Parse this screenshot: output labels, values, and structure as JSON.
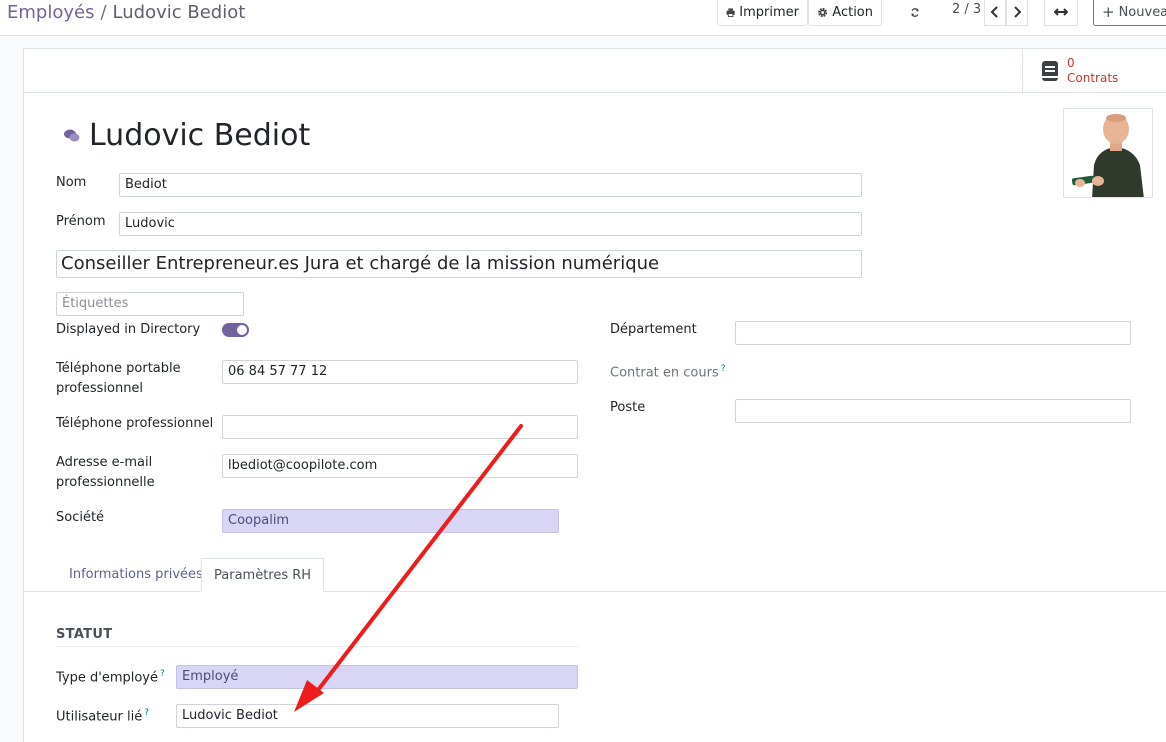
{
  "breadcrumb": {
    "parent": "Employés",
    "separator": "/",
    "current": "Ludovic Bediot"
  },
  "toolbar": {
    "print_label": "Imprimer",
    "action_label": "Action",
    "pager": "2 / 3",
    "new_label": "Nouveau"
  },
  "smart_buttons": {
    "contracts_count": "0",
    "contracts_label": "Contrats"
  },
  "employee": {
    "name": "Ludovic Bediot",
    "nom_label": "Nom",
    "nom": "Bediot",
    "prenom_label": "Prénom",
    "prenom": "Ludovic",
    "job_title": "Conseiller Entrepreneur.es Jura et chargé de la mission numérique",
    "tags_placeholder": "Étiquettes"
  },
  "fields": {
    "directory_label": "Displayed in Directory",
    "directory_on": true,
    "mobile_label_1": "Téléphone portable",
    "mobile_label_2": "professionnel",
    "mobile": "06 84 57 77 12",
    "phone_label": "Téléphone professionnel",
    "phone": "",
    "email_label_1": "Adresse e-mail",
    "email_label_2": "professionnelle",
    "email": "lbediot@coopilote.com",
    "company_label": "Société",
    "company": "Coopalim",
    "department_label": "Département",
    "department": "",
    "contract_label": "Contrat en cours",
    "help_mark": "?",
    "position_label": "Poste",
    "position": ""
  },
  "tabs": [
    {
      "label": "Informations privées"
    },
    {
      "label": "Paramètres RH"
    }
  ],
  "statut": {
    "title": "STATUT",
    "type_label": "Type d'employé",
    "type": "Employé",
    "user_label": "Utilisateur lié",
    "user": "Ludovic Bediot"
  },
  "colors": {
    "accent": "#71639e",
    "annotation_arrow": "#ee1c1c",
    "readonly_bg": "#d8d5f5"
  },
  "icons": [
    "print-icon",
    "gear-icon",
    "refresh-icon",
    "chevron-left-icon",
    "chevron-right-icon",
    "expand-icon",
    "plus-icon",
    "book-icon",
    "comments-icon"
  ]
}
